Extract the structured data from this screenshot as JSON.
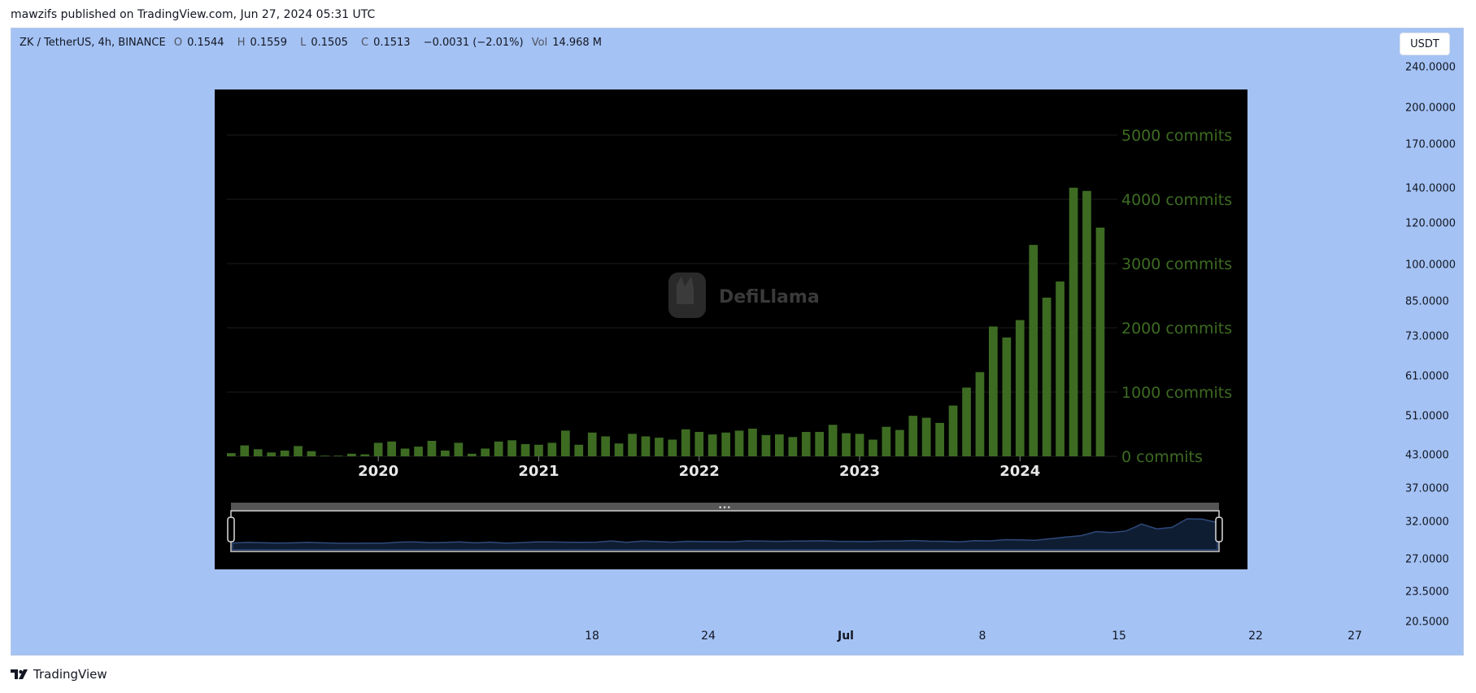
{
  "published_line": "mawzifs published on TradingView.com, Jun 27, 2024 05:31 UTC",
  "legend": {
    "symbol": "ZK / TetherUS, 4h, BINANCE",
    "open_label": "O",
    "open": "0.1544",
    "high_label": "H",
    "high": "0.1559",
    "low_label": "L",
    "low": "0.1505",
    "close_label": "C",
    "close": "0.1513",
    "change": "−0.0031 (−2.01%)",
    "vol_label": "Vol",
    "vol": "14.968 M"
  },
  "currency_button": "USDT",
  "price_axis": [
    "240.0000",
    "200.0000",
    "170.0000",
    "140.0000",
    "120.0000",
    "100.0000",
    "85.0000",
    "73.0000",
    "61.0000",
    "51.0000",
    "43.0000",
    "37.0000",
    "32.0000",
    "27.0000",
    "23.5000",
    "20.5000"
  ],
  "time_axis": [
    {
      "label": "18",
      "bold": false
    },
    {
      "label": "24",
      "bold": false
    },
    {
      "label": "Jul",
      "bold": true
    },
    {
      "label": "8",
      "bold": false
    },
    {
      "label": "15",
      "bold": false
    },
    {
      "label": "22",
      "bold": false
    },
    {
      "label": "27",
      "bold": false
    }
  ],
  "footer_brand": "TradingView",
  "watermark": "DefiLlama",
  "chart_data": {
    "type": "bar",
    "ylabel_unit": "commits",
    "ylim": [
      0,
      5000
    ],
    "y_ticks": [
      "0 commits",
      "1000 commits",
      "2000 commits",
      "3000 commits",
      "4000 commits",
      "5000 commits"
    ],
    "x_tick_labels": [
      "2020",
      "2021",
      "2022",
      "2023",
      "2024"
    ],
    "bar_color": "#3d6b22",
    "values": [
      50,
      170,
      110,
      60,
      90,
      160,
      80,
      10,
      10,
      40,
      30,
      210,
      230,
      120,
      150,
      240,
      90,
      210,
      40,
      120,
      230,
      250,
      190,
      180,
      210,
      400,
      180,
      370,
      310,
      200,
      350,
      310,
      290,
      260,
      420,
      380,
      340,
      370,
      400,
      430,
      330,
      340,
      300,
      380,
      380,
      490,
      360,
      350,
      260,
      460,
      410,
      630,
      600,
      520,
      790,
      1070,
      1310,
      2020,
      1850,
      2120,
      3290,
      2470,
      2720,
      4180,
      4130,
      3560
    ]
  }
}
